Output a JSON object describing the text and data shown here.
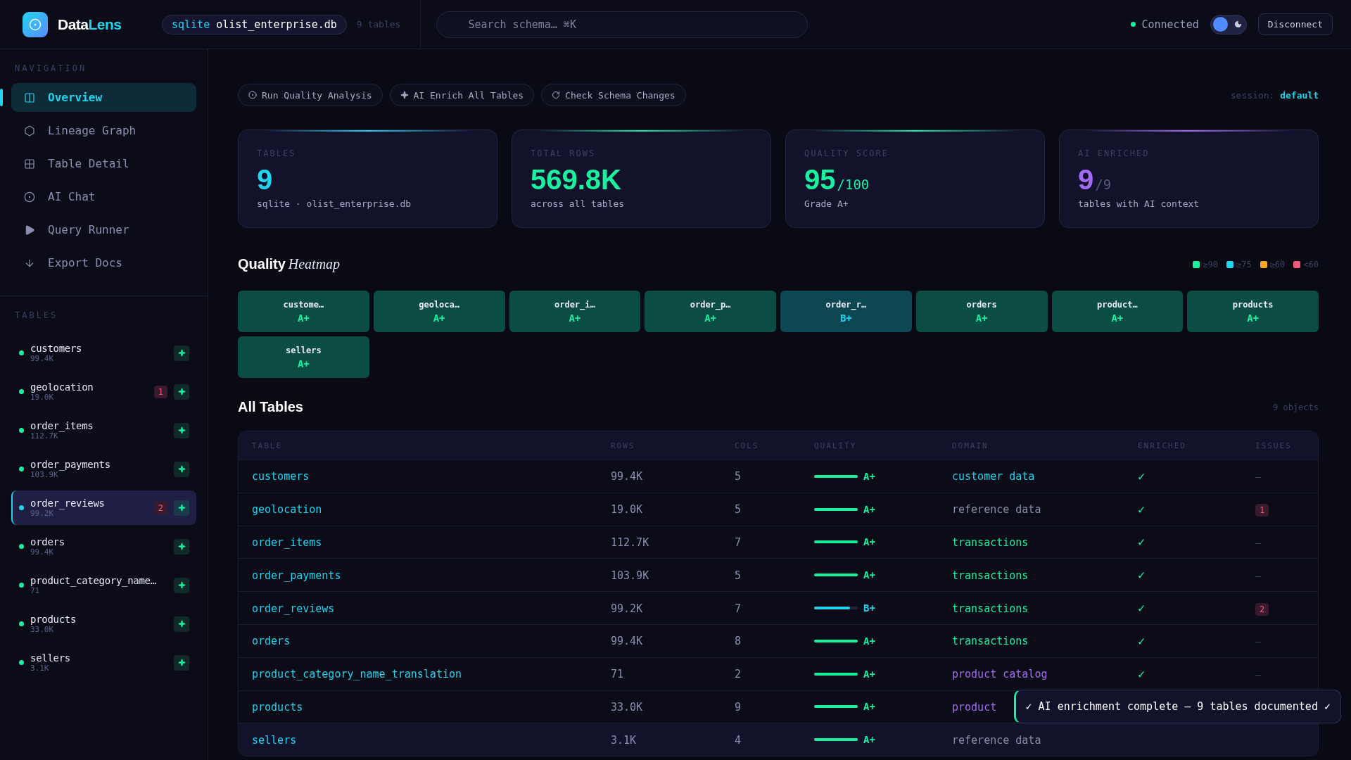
{
  "topbar": {
    "brand_1": "Data",
    "brand_2": "Lens",
    "db": {
      "engine": "sqlite",
      "file": "olist_enterprise.db",
      "count": "9 tables"
    },
    "search": {
      "placeholder": "Search schema… ⌘K"
    },
    "status": "Connected",
    "theme_toggle": {
      "on": false
    },
    "disconnect": "Disconnect"
  },
  "sidebar": {
    "nav_label": "NAVIGATION",
    "nav": [
      {
        "label": "Overview",
        "kind": "columns",
        "selected": true
      },
      {
        "label": "Lineage Graph",
        "kind": "hexagon",
        "selected": false
      },
      {
        "label": "Table Detail",
        "kind": "grid",
        "selected": false
      },
      {
        "label": "AI Chat",
        "kind": "target",
        "selected": false
      },
      {
        "label": "Query Runner",
        "kind": "play",
        "selected": false
      },
      {
        "label": "Export Docs",
        "kind": "download",
        "selected": false
      }
    ],
    "tables_label": "TABLES",
    "tables": [
      {
        "name": "customers",
        "rows": "99.4K",
        "selected": false
      },
      {
        "name": "geolocation",
        "rows": "19.0K",
        "issues": "1",
        "selected": false
      },
      {
        "name": "order_items",
        "rows": "112.7K",
        "selected": false
      },
      {
        "name": "order_payments",
        "rows": "103.9K",
        "selected": false
      },
      {
        "name": "order_reviews",
        "rows": "99.2K",
        "issues": "2",
        "selected": true
      },
      {
        "name": "orders",
        "rows": "99.4K",
        "selected": false
      },
      {
        "name": "product_category_name…",
        "rows": "71",
        "selected": false
      },
      {
        "name": "products",
        "rows": "33.0K",
        "selected": false
      },
      {
        "name": "sellers",
        "rows": "3.1K",
        "selected": false
      }
    ]
  },
  "actions": [
    {
      "label": "Run Quality Analysis",
      "kind": "target"
    },
    {
      "label": "AI Enrich All Tables",
      "kind": "sparkle"
    },
    {
      "label": "Check Schema Changes",
      "kind": "refresh"
    }
  ],
  "session": {
    "label": "session:",
    "value": "default"
  },
  "stats": [
    {
      "label": "TABLES",
      "value": "9",
      "caption": "sqlite · olist_enterprise.db",
      "color": "#22d3ee"
    },
    {
      "label": "TOTAL ROWS",
      "value": "569.8K",
      "caption": "across all tables",
      "color": "#19f0a0"
    },
    {
      "label": "QUALITY SCORE",
      "value": "95",
      "suffix": {
        "text": "/100",
        "muted": false
      },
      "caption": "Grade A+",
      "color": "#19f0a0"
    },
    {
      "label": "AI ENRICHED",
      "value": "9",
      "suffix": {
        "text": "/9",
        "muted": true
      },
      "caption": "tables with AI context",
      "color": "#a46cf5"
    }
  ],
  "heatmap": {
    "title": "Quality",
    "title_accent": "Heatmap",
    "legend": [
      {
        "label": "≥90",
        "color": "#19f0a0"
      },
      {
        "label": "≥75",
        "color": "#22d3ee"
      },
      {
        "label": "≥60",
        "color": "#f5a524"
      },
      {
        "label": "<60",
        "color": "#f5587b"
      }
    ],
    "tiles": [
      {
        "name": "custome…",
        "grade": "A+",
        "color": "#19f0a0"
      },
      {
        "name": "geoloca…",
        "grade": "A+",
        "color": "#19f0a0"
      },
      {
        "name": "order_i…",
        "grade": "A+",
        "color": "#19f0a0"
      },
      {
        "name": "order_p…",
        "grade": "A+",
        "color": "#19f0a0"
      },
      {
        "name": "order_r…",
        "grade": "B+",
        "color": "#22d3ee"
      },
      {
        "name": "orders",
        "grade": "A+",
        "color": "#19f0a0"
      },
      {
        "name": "product…",
        "grade": "A+",
        "color": "#19f0a0"
      },
      {
        "name": "products",
        "grade": "A+",
        "color": "#19f0a0"
      },
      {
        "name": "sellers",
        "grade": "A+",
        "color": "#19f0a0"
      }
    ]
  },
  "all_tables": {
    "title": "All Tables",
    "count": "9 objects",
    "columns": [
      "TABLE",
      "ROWS",
      "COLS",
      "QUALITY",
      "DOMAIN",
      "ENRICHED",
      "ISSUES"
    ],
    "rows": [
      {
        "table": "customers",
        "rows": "99.4K",
        "cols": "5",
        "quality": {
          "grade": "A+",
          "level": 1,
          "color": "#19f0a0"
        },
        "domain": {
          "text": "customer data",
          "color": "#22d3ee"
        },
        "enriched": "✓",
        "issues": {
          "kind": "none",
          "text": "—"
        },
        "selected": false
      },
      {
        "table": "geolocation",
        "rows": "19.0K",
        "cols": "5",
        "quality": {
          "grade": "A+",
          "level": 1,
          "color": "#19f0a0"
        },
        "domain": {
          "text": "reference data",
          "color": "#8a8fa8"
        },
        "enriched": "✓",
        "issues": {
          "kind": "badge",
          "text": "1"
        },
        "selected": false
      },
      {
        "table": "order_items",
        "rows": "112.7K",
        "cols": "7",
        "quality": {
          "grade": "A+",
          "level": 1,
          "color": "#19f0a0"
        },
        "domain": {
          "text": "transactions",
          "color": "#19f0a0"
        },
        "enriched": "✓",
        "issues": {
          "kind": "none",
          "text": "—"
        },
        "selected": false
      },
      {
        "table": "order_payments",
        "rows": "103.9K",
        "cols": "5",
        "quality": {
          "grade": "A+",
          "level": 1,
          "color": "#19f0a0"
        },
        "domain": {
          "text": "transactions",
          "color": "#19f0a0"
        },
        "enriched": "✓",
        "issues": {
          "kind": "none",
          "text": "—"
        },
        "selected": false
      },
      {
        "table": "order_reviews",
        "rows": "99.2K",
        "cols": "7",
        "quality": {
          "grade": "B+",
          "level": 0.82,
          "color": "#22d3ee"
        },
        "domain": {
          "text": "transactions",
          "color": "#19f0a0"
        },
        "enriched": "✓",
        "issues": {
          "kind": "badge",
          "text": "2"
        },
        "selected": false
      },
      {
        "table": "orders",
        "rows": "99.4K",
        "cols": "8",
        "quality": {
          "grade": "A+",
          "level": 1,
          "color": "#19f0a0"
        },
        "domain": {
          "text": "transactions",
          "color": "#19f0a0"
        },
        "enriched": "✓",
        "issues": {
          "kind": "none",
          "text": "—"
        },
        "selected": false
      },
      {
        "table": "product_category_name_translation",
        "rows": "71",
        "cols": "2",
        "quality": {
          "grade": "A+",
          "level": 1,
          "color": "#19f0a0"
        },
        "domain": {
          "text": "product catalog",
          "color": "#a46cf5"
        },
        "enriched": "✓",
        "issues": {
          "kind": "none",
          "text": "—"
        },
        "selected": false
      },
      {
        "table": "products",
        "rows": "33.0K",
        "cols": "9",
        "quality": {
          "grade": "A+",
          "level": 1,
          "color": "#19f0a0"
        },
        "domain": {
          "text": "product",
          "color": "#a46cf5"
        },
        "selected": false
      },
      {
        "table": "sellers",
        "rows": "3.1K",
        "cols": "4",
        "quality": {
          "grade": "A+",
          "level": 1,
          "color": "#19f0a0"
        },
        "domain": {
          "text": "reference data",
          "color": "#8a8fa8"
        },
        "selected": true
      }
    ]
  },
  "toast": "✓ AI enrichment complete — 9 tables documented ✓"
}
